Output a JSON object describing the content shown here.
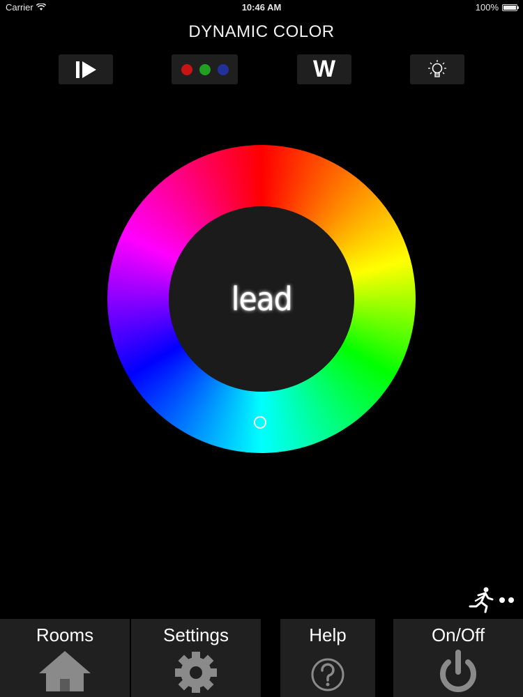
{
  "status_bar": {
    "carrier": "Carrier",
    "time": "10:46 AM",
    "battery": "100%"
  },
  "header": {
    "title": "DYNAMIC COLOR"
  },
  "toolbar": {
    "items": [
      {
        "name": "play-pause",
        "icon": "play-pause-icon"
      },
      {
        "name": "rgb",
        "icon": "rgb-dots-icon",
        "colors": [
          "#cc1111",
          "#22aa22",
          "#2233aa"
        ]
      },
      {
        "name": "white",
        "label": "W"
      },
      {
        "name": "bulb",
        "icon": "lightbulb-icon"
      }
    ]
  },
  "wheel": {
    "brand": "lead"
  },
  "bottom_nav": {
    "items": [
      {
        "label": "Rooms",
        "icon": "home-icon"
      },
      {
        "label": "Settings",
        "icon": "gear-icon"
      },
      {
        "label": "Help",
        "icon": "help-icon"
      },
      {
        "label": "On/Off",
        "icon": "power-icon"
      }
    ]
  }
}
